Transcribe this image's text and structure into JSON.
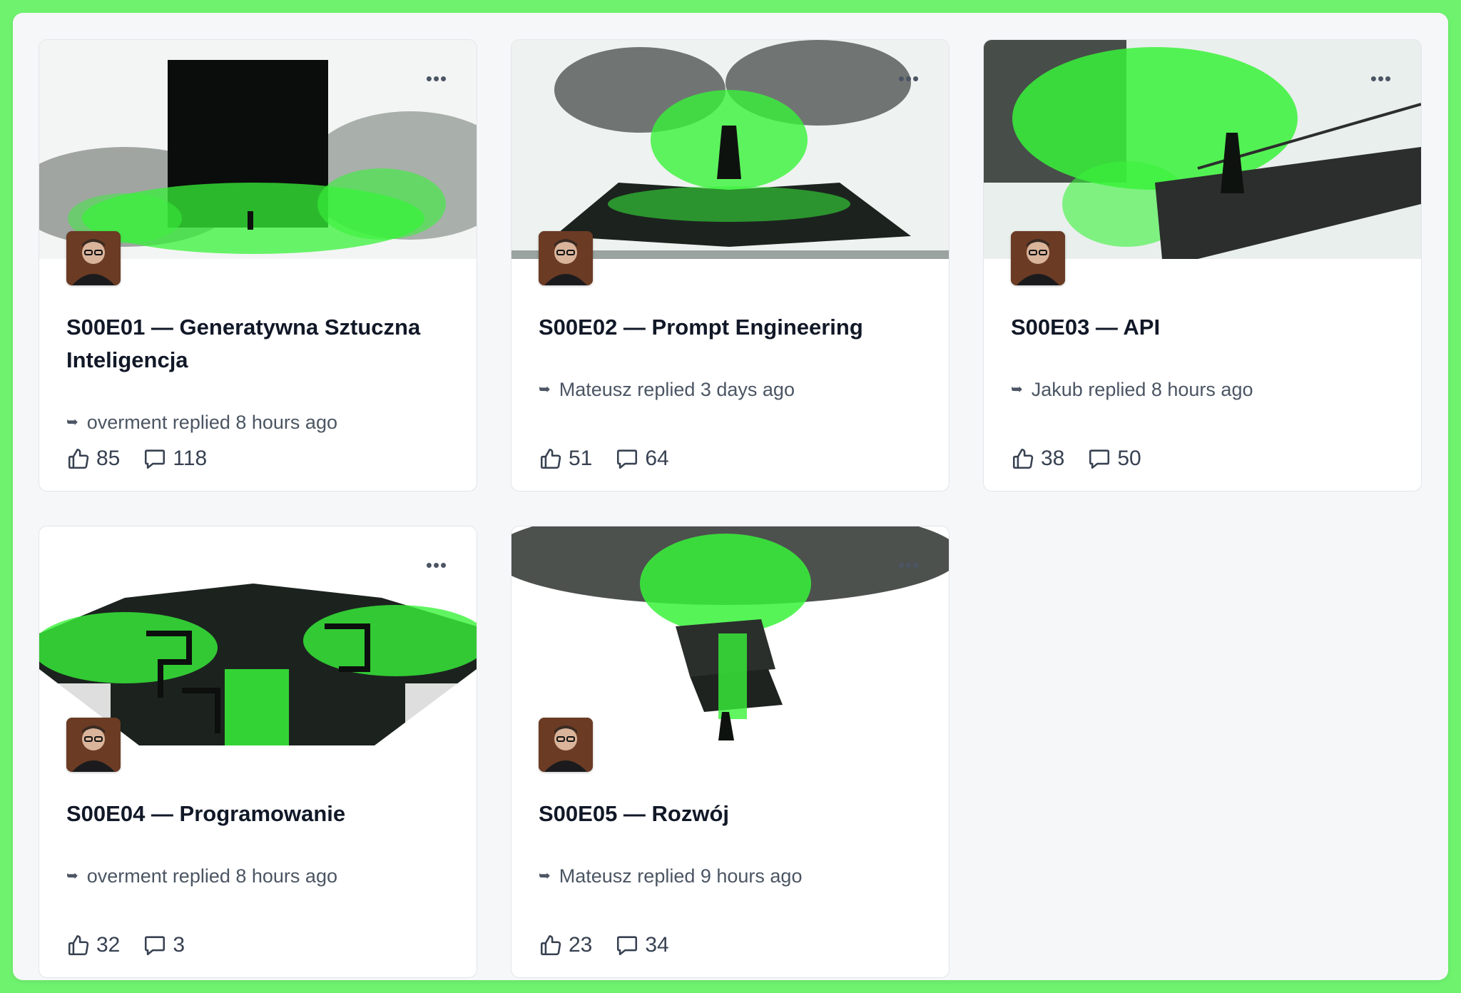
{
  "accent": "#39f53c",
  "cards": [
    {
      "title": "S00E01 — Generatywna Sztuczna Inteligencja",
      "reply": "overment replied 8 hours ago",
      "likes": "85",
      "comments": "118",
      "icon_more": "more-horizontal-icon"
    },
    {
      "title": "S00E02 — Prompt Engineering",
      "reply": "Mateusz replied 3 days ago",
      "likes": "51",
      "comments": "64",
      "icon_more": "more-horizontal-icon"
    },
    {
      "title": "S00E03 — API",
      "reply": "Jakub replied 8 hours ago",
      "likes": "38",
      "comments": "50",
      "icon_more": "more-horizontal-icon"
    },
    {
      "title": "S00E04 — Programowanie",
      "reply": "overment replied 8 hours ago",
      "likes": "32",
      "comments": "3",
      "icon_more": "more-horizontal-icon"
    },
    {
      "title": "S00E05 — Rozwój",
      "reply": "Mateusz replied 9 hours ago",
      "likes": "23",
      "comments": "34",
      "icon_more": "more-horizontal-icon"
    }
  ],
  "icons": {
    "reply": "reply-arrow-icon",
    "like": "thumbs-up-icon",
    "comment": "comment-icon",
    "more": "more-horizontal-icon"
  }
}
